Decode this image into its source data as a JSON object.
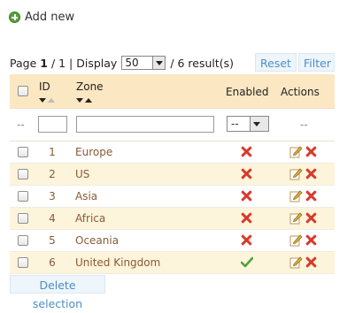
{
  "toolbar": {
    "add_new_label": "Add new"
  },
  "pager": {
    "page_prefix": "Page",
    "page_current": "1",
    "page_sep": "/ 1 | Display",
    "per_page": "50",
    "results": "/ 6 result(s)",
    "reset_label": "Reset",
    "filter_label": "Filter"
  },
  "table": {
    "columns": {
      "id": "ID",
      "zone": "Zone",
      "enabled": "Enabled",
      "actions": "Actions"
    },
    "filters": {
      "dash": "--",
      "enabled_value": "--"
    },
    "rows": [
      {
        "id": "1",
        "zone": "Europe",
        "enabled": false
      },
      {
        "id": "2",
        "zone": "US",
        "enabled": false
      },
      {
        "id": "3",
        "zone": "Asia",
        "enabled": false
      },
      {
        "id": "4",
        "zone": "Africa",
        "enabled": false
      },
      {
        "id": "5",
        "zone": "Oceania",
        "enabled": false
      },
      {
        "id": "6",
        "zone": "United Kingdom",
        "enabled": true
      }
    ]
  },
  "footer": {
    "delete_selection_label": "Delete selection"
  },
  "colors": {
    "header_bg": "#fbe7c2",
    "row_alt_bg": "#fdf4dc",
    "link_text": "#8a5a34",
    "button_text": "#4a8fc5"
  }
}
